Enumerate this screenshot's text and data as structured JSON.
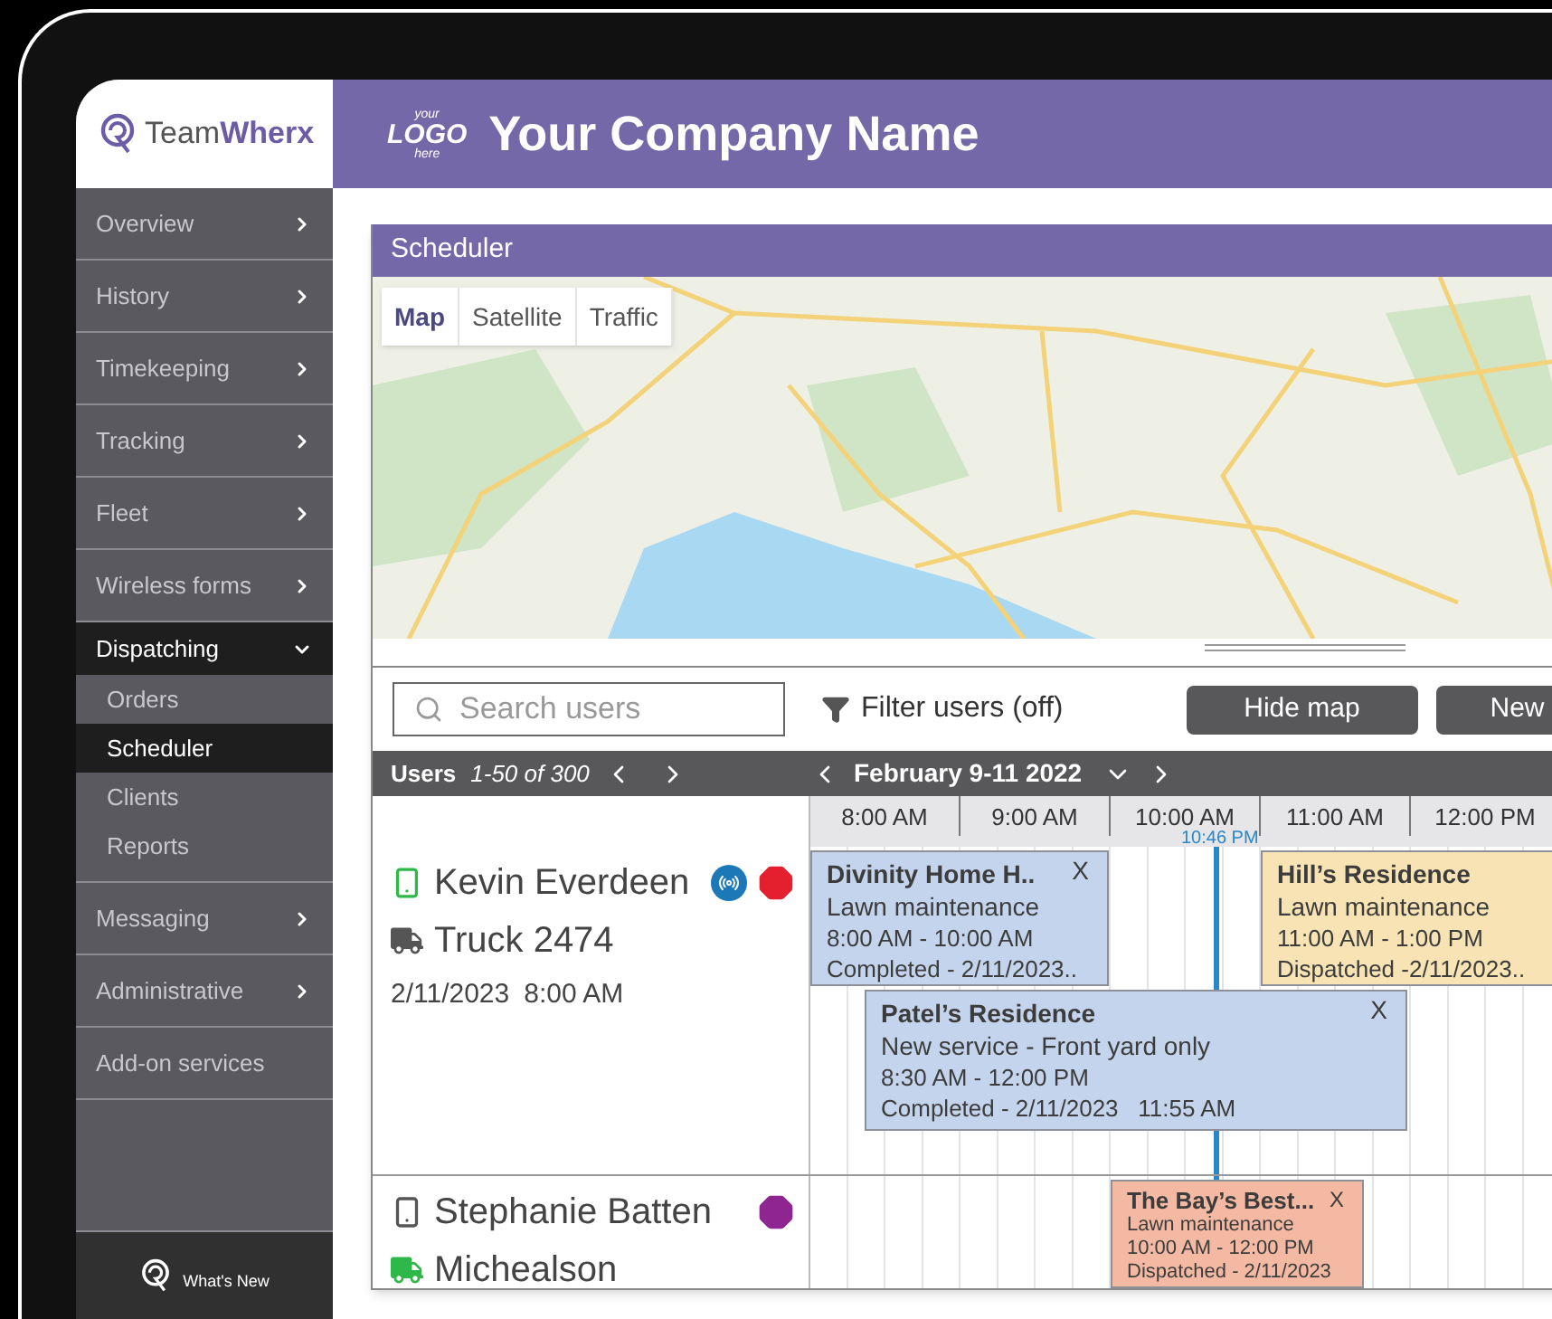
{
  "brand": {
    "name": "Team**Wherx**"
  },
  "sidebar": {
    "items": [
      {
        "label": "Overview",
        "kind": "menu",
        "expanded": false
      },
      {
        "label": "History",
        "kind": "menu",
        "expanded": false
      },
      {
        "label": "Timekeeping",
        "kind": "menu",
        "expanded": false
      },
      {
        "label": "Tracking",
        "kind": "menu",
        "expanded": false
      },
      {
        "label": "Fleet",
        "kind": "menu",
        "expanded": false
      },
      {
        "label": "Wireless forms",
        "kind": "menu",
        "expanded": false
      },
      {
        "label": "Dispatching",
        "kind": "menu",
        "expanded": true,
        "children": [
          {
            "label": "Orders",
            "selected": false
          },
          {
            "label": "Scheduler",
            "selected": true
          },
          {
            "label": "Clients",
            "selected": false
          },
          {
            "label": "Reports",
            "selected": false
          }
        ]
      },
      {
        "label": "Messaging",
        "kind": "menu",
        "expanded": false
      },
      {
        "label": "Administrative",
        "kind": "menu",
        "expanded": false
      },
      {
        "label": "Add-on services",
        "kind": "link"
      }
    ],
    "footer": "What's New"
  },
  "header": {
    "logo_lines": [
      "your",
      "LOGO",
      "here"
    ],
    "company": "Your Company Name"
  },
  "scheduler": {
    "title": "Scheduler",
    "map_types": [
      {
        "label": "Map",
        "selected": true
      },
      {
        "label": "Satellite",
        "selected": false
      },
      {
        "label": "Traffic",
        "selected": false
      }
    ],
    "search": {
      "placeholder": "Search users"
    },
    "filter": "Filter users (off)",
    "buttons": [
      "Hide map",
      "New"
    ],
    "users_label": "Users",
    "users_range": "1-50 of 300",
    "date_range": "February 9-11 2022",
    "hours": [
      "8:00 AM",
      "9:00 AM",
      "10:00 AM",
      "11:00 AM",
      "12:00 PM"
    ],
    "now": "10:46 PM",
    "users": [
      {
        "name": "Kevin Everdeen",
        "device": {
          "color": "#2eb84a"
        },
        "radio": true,
        "status": {
          "color": "#e5202e"
        },
        "vehicle": {
          "label": "Truck 2474",
          "color": "#555555"
        },
        "date": "2/11/2023",
        "time": "8:00 AM",
        "events": [
          {
            "title": "Divinity Home H..",
            "subtitle": "Lawn maintenance",
            "time": "8:00 AM - 10:00 AM",
            "status": "Completed - 2/11/2023..",
            "close": "X",
            "color": "#c3d4ec"
          },
          {
            "title": "Hill’s Residence",
            "subtitle": "Lawn maintenance",
            "time": "11:00 AM - 1:00 PM",
            "status": "Dispatched -2/11/2023..",
            "color": "#f7e3b4"
          },
          {
            "title": "Patel’s Residence",
            "subtitle": "New service - Front yard only",
            "time": "8:30 AM - 12:00 PM",
            "status": "Completed - 2/11/2023   11:55 AM",
            "close": "X",
            "color": "#c3d4ec"
          }
        ]
      },
      {
        "name": "Stephanie Batten",
        "device": {
          "color": "#555555"
        },
        "radio": false,
        "status": {
          "color": "#8e2591"
        },
        "vehicle": {
          "label": "Michealson",
          "color": "#2eb84a"
        },
        "events": [
          {
            "title": "The Bay’s Best...",
            "subtitle": "Lawn maintenance",
            "time": "10:00 AM - 12:00 PM",
            "status": "Dispatched - 2/11/2023",
            "close": "X",
            "color": "#f4b9a2"
          }
        ]
      }
    ]
  }
}
